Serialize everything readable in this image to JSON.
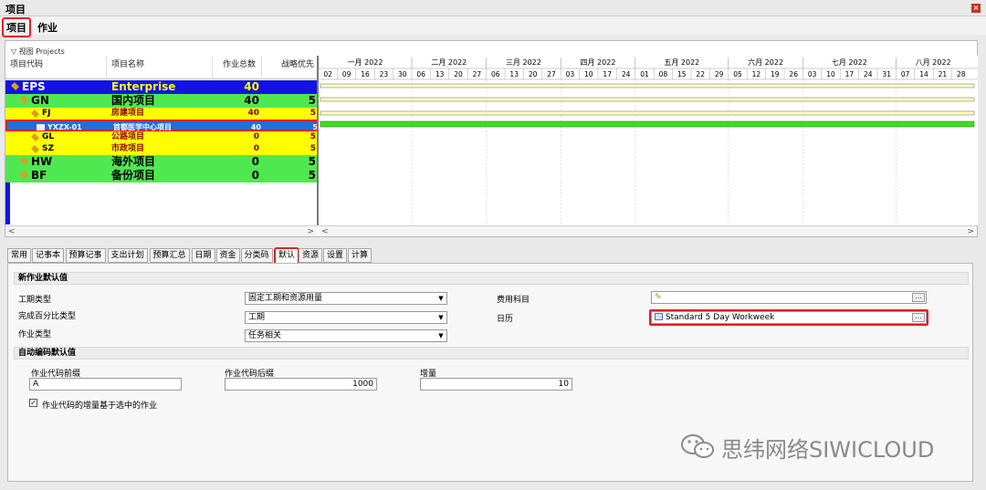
{
  "window": {
    "title": "项目",
    "close_glyph": "×"
  },
  "menu": {
    "project": "项目",
    "task": "作业"
  },
  "view": {
    "label": "视图 Projects"
  },
  "columns": {
    "code": "项目代码",
    "name": "项目名称",
    "total": "作业总数",
    "priority": "战略优先"
  },
  "rows": [
    {
      "code": "EPS",
      "name": "Enterprise",
      "total": "40",
      "priority": "",
      "color": "#1414e0",
      "text_color": "#ffff00",
      "big": true
    },
    {
      "code": "GN",
      "name": "国内项目",
      "total": "40",
      "priority": "5",
      "color": "#50e850",
      "text_color": "#000000",
      "big": true
    },
    {
      "code": "FJ",
      "name": "房建项目",
      "total": "40",
      "priority": "5",
      "color": "#ffff00",
      "text_color": "#8b0000",
      "big": false
    },
    {
      "code": "YXZX-01",
      "name": "首都医学中心项目",
      "total": "40",
      "priority": "5",
      "color": "#1f6fd8",
      "text_color": "#ffffff",
      "big": false
    },
    {
      "code": "GL",
      "name": "公路项目",
      "total": "0",
      "priority": "5",
      "color": "#ffff00",
      "text_color": "#8b0000",
      "big": false
    },
    {
      "code": "SZ",
      "name": "市政项目",
      "total": "0",
      "priority": "5",
      "color": "#ffff00",
      "text_color": "#8b0000",
      "big": false
    },
    {
      "code": "HW",
      "name": "海外项目",
      "total": "0",
      "priority": "5",
      "color": "#50e850",
      "text_color": "#000000",
      "big": true
    },
    {
      "code": "BF",
      "name": "备份项目",
      "total": "0",
      "priority": "5",
      "color": "#50e850",
      "text_color": "#000000",
      "big": true
    }
  ],
  "gantt": {
    "months": [
      "一月 2022",
      "二月 2022",
      "三月 2022",
      "四月 2022",
      "五月 2022",
      "六月 2022",
      "七月 2022",
      "八月 2022"
    ],
    "days": [
      "02",
      "09",
      "16",
      "23",
      "30",
      "06",
      "13",
      "20",
      "27",
      "06",
      "13",
      "20",
      "27",
      "03",
      "10",
      "17",
      "24",
      "01",
      "08",
      "15",
      "22",
      "29",
      "05",
      "12",
      "19",
      "26",
      "03",
      "10",
      "17",
      "24",
      "31",
      "07",
      "14",
      "21",
      "28"
    ],
    "bar_color": "#40dc20"
  },
  "tabs": [
    "常用",
    "记事本",
    "预算记事",
    "支出计划",
    "预算汇总",
    "日期",
    "资金",
    "分类码",
    "默认",
    "资源",
    "设置",
    "计算"
  ],
  "defaults": {
    "section_new": "新作业默认值",
    "duration_type_label": "工期类型",
    "duration_type_value": "固定工期和资源用量",
    "percent_type_label": "完成百分比类型",
    "percent_type_value": "工期",
    "activity_type_label": "作业类型",
    "activity_type_value": "任务相关",
    "cost_account_label": "费用科目",
    "cost_account_value": "",
    "calendar_label": "日历",
    "calendar_value": "Standard 5 Day Workweek",
    "section_auto": "自动编码默认值",
    "prefix_label": "作业代码前缀",
    "prefix_value": "A",
    "suffix_label": "作业代码后缀",
    "suffix_value": "1000",
    "increment_label": "增量",
    "increment_value": "10",
    "checkbox_label": "作业代码的增量基于选中的作业",
    "checkbox_checked": true
  },
  "watermark": {
    "text": "思纬网络SIWICLOUD"
  }
}
